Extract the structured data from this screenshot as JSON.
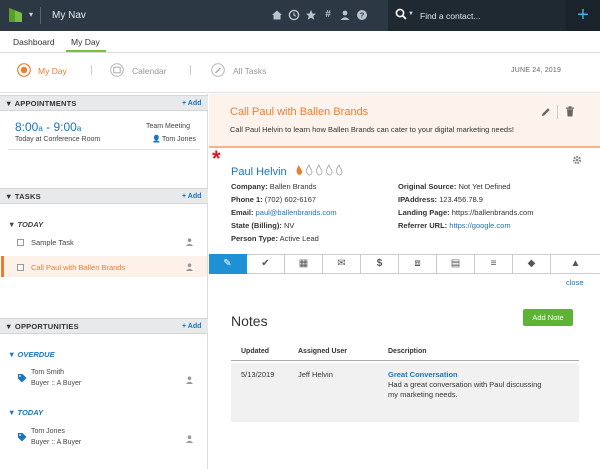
{
  "topbar": {
    "nav_title": "My Nav",
    "search_placeholder": "Find a contact...",
    "icons": [
      "home-icon",
      "clock-icon",
      "star-icon",
      "hashtag-icon",
      "person-icon",
      "help-icon"
    ],
    "plus": "+"
  },
  "tabs": [
    {
      "label": "Dashboard"
    },
    {
      "label": "My Day"
    }
  ],
  "subheader": {
    "views": [
      {
        "label": "My Day"
      },
      {
        "label": "Calendar"
      },
      {
        "label": "All Tasks"
      }
    ],
    "date": "JUNE 24, 2019"
  },
  "appointments": {
    "title": "APPOINTMENTS",
    "add": "+ Add",
    "items": [
      {
        "start": "8:00",
        "start_ampm": "a",
        "dash": "-",
        "end": "9:00",
        "end_ampm": "a",
        "type": "Team Meeting",
        "location": "Today at Conference Room",
        "person": "Tom Jones"
      }
    ]
  },
  "tasks": {
    "title": "TASKS",
    "add": "+ Add",
    "group": "TODAY",
    "items": [
      {
        "label": "Sample Task"
      },
      {
        "label": "Call Paul with Ballen Brands"
      }
    ]
  },
  "opportunities": {
    "title": "OPPORTUNITIES",
    "add": "+ Add",
    "groups": [
      {
        "label": "OVERDUE",
        "name": "Tom Smith",
        "stage": "Buyer :: A Buyer"
      },
      {
        "label": "TODAY",
        "name": "Tom Jones",
        "stage": "Buyer :: A Buyer"
      }
    ]
  },
  "task_detail": {
    "title": "Call Paul with Ballen Brands",
    "description": "Call Paul Helvin to learn how Ballen Brands can cater to your digital marketing needs!"
  },
  "contact": {
    "asterisk": "*",
    "name": "Paul Helvin",
    "left_fields": [
      {
        "label": "Company:",
        "value": "Ballen Brands"
      },
      {
        "label": "Phone 1:",
        "value": "(702) 602-6167"
      },
      {
        "label": "Email:",
        "value": "paul@ballenbrands.com"
      },
      {
        "label": "State (Billing):",
        "value": "NV"
      },
      {
        "label": "Person Type:",
        "value": "Active Lead"
      }
    ],
    "right_fields": [
      {
        "label": "Original Source:",
        "value": "Not Yet Defined"
      },
      {
        "label": "IPAddress:",
        "value": "123.456.78.9"
      },
      {
        "label": "Landing Page:",
        "value": "https://ballenbrands.com"
      },
      {
        "label": "Referrer URL:",
        "value": "https://google.com"
      }
    ]
  },
  "close_link": "close",
  "notes": {
    "title": "Notes",
    "add_button": "Add Note",
    "columns": [
      "Updated",
      "Assigned User",
      "Description"
    ],
    "rows": [
      {
        "updated": "5/13/2019",
        "user": "Jeff Helvin",
        "desc_title": "Great Conversation",
        "desc_line1": "Had a great conversation with Paul discussing",
        "desc_line2": "my marketing needs."
      }
    ]
  },
  "colors": {
    "topbar": "#2c3844",
    "accent_orange": "#ed7d31",
    "accent_blue": "#1b75bb",
    "accent_green": "#5cb335"
  }
}
